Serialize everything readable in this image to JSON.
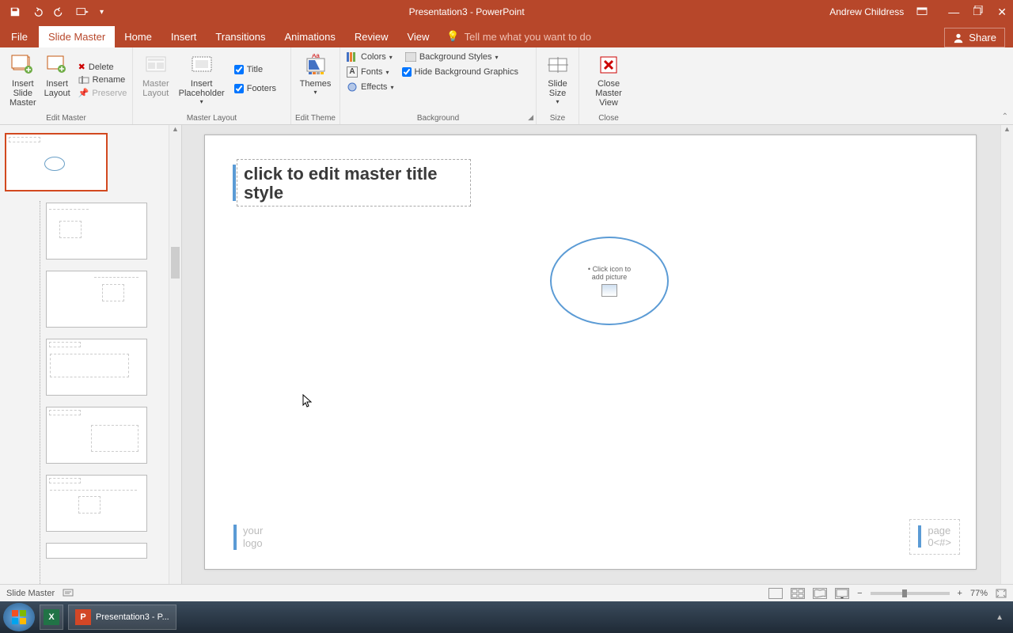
{
  "title_bar": {
    "doc_title": "Presentation3  -  PowerPoint",
    "user": "Andrew Childress"
  },
  "tabs": {
    "file": "File",
    "slide_master": "Slide Master",
    "home": "Home",
    "insert": "Insert",
    "transitions": "Transitions",
    "animations": "Animations",
    "review": "Review",
    "view": "View",
    "tell_me": "Tell me what you want to do",
    "share": "Share"
  },
  "ribbon": {
    "edit_master": {
      "insert_slide_master": "Insert Slide\nMaster",
      "insert_layout": "Insert\nLayout",
      "delete": "Delete",
      "rename": "Rename",
      "preserve": "Preserve",
      "group": "Edit Master"
    },
    "master_layout": {
      "master_layout": "Master\nLayout",
      "insert_placeholder": "Insert\nPlaceholder",
      "title": "Title",
      "footers": "Footers",
      "group": "Master Layout"
    },
    "edit_theme": {
      "themes": "Themes",
      "group": "Edit Theme"
    },
    "background": {
      "colors": "Colors",
      "fonts": "Fonts",
      "effects": "Effects",
      "bg_styles": "Background Styles",
      "hide_bg": "Hide Background Graphics",
      "group": "Background"
    },
    "size": {
      "slide_size": "Slide\nSize",
      "group": "Size"
    },
    "close": {
      "close_master": "Close\nMaster View",
      "group": "Close"
    }
  },
  "slide": {
    "title_placeholder": "click to edit master title style",
    "pic_placeholder": "Click icon to\nadd picture",
    "footer_left": "your\nlogo",
    "footer_right_label": "page",
    "footer_right_num": "0<#>"
  },
  "status": {
    "mode": "Slide Master",
    "zoom": "77%"
  },
  "taskbar": {
    "ppt_label": "Presentation3 - P..."
  }
}
